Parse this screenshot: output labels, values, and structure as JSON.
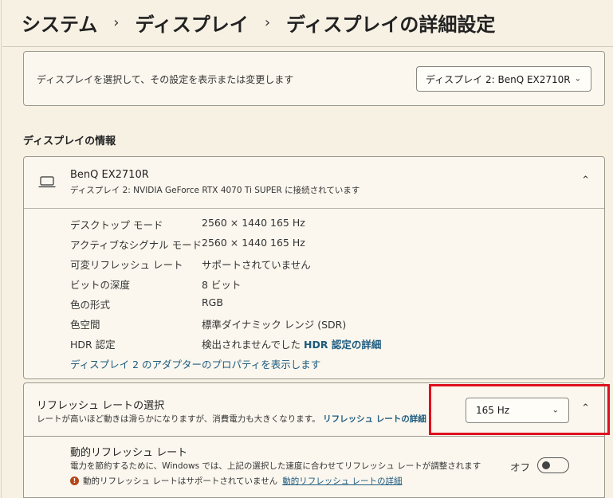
{
  "breadcrumb": {
    "items": [
      "システム",
      "ディスプレイ",
      "ディスプレイの詳細設定"
    ],
    "separator": "›"
  },
  "display_select": {
    "text": "ディスプレイを選択して、その設定を表示または変更します",
    "selected": "ディスプレイ 2: BenQ EX2710R"
  },
  "info_section": {
    "heading": "ディスプレイの情報",
    "monitor_name": "BenQ EX2710R",
    "monitor_sub": "ディスプレイ 2: NVIDIA GeForce RTX 4070 Ti SUPER に接続されています",
    "rows": [
      {
        "label": "デスクトップ モード",
        "value": "2560 × 1440 165 Hz"
      },
      {
        "label": "アクティブなシグナル モード",
        "value": "2560 × 1440 165 Hz"
      },
      {
        "label": "可変リフレッシュ レート",
        "value": "サポートされていません"
      },
      {
        "label": "ビットの深度",
        "value": "8 ビット"
      },
      {
        "label": "色の形式",
        "value": "RGB"
      },
      {
        "label": "色空間",
        "value": "標準ダイナミック レンジ (SDR)"
      },
      {
        "label": "HDR 認定",
        "value": "検出されませんでした"
      }
    ],
    "hdr_link": "HDR 認定の詳細",
    "adapter_link": "ディスプレイ 2 のアダプターのプロパティを表示します"
  },
  "refresh": {
    "title": "リフレッシュ レートの選択",
    "desc": "レートが高いほど動きは滑らかになりますが、消費電力も大きくなります。",
    "link": "リフレッシュ レートの詳細",
    "selected": "165 Hz"
  },
  "dynamic": {
    "title": "動的リフレッシュ レート",
    "desc": "電力を節約するために、Windows では、上記の選択した速度に合わせてリフレッシュ レートが調整されます",
    "warning": "動的リフレッシュ レートはサポートされていません",
    "warning_link": "動的リフレッシュ レートの詳細",
    "toggle_label": "オフ",
    "toggle_on": false
  },
  "colors": {
    "accent_link": "#1c5a7e",
    "highlight_box": "#e0101e",
    "warning_icon": "#b5461a"
  }
}
